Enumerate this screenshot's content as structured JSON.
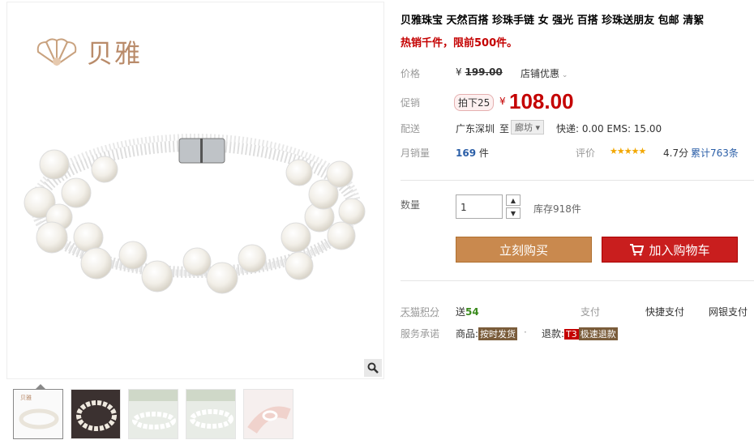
{
  "brand": {
    "logo_text": "贝雅"
  },
  "product": {
    "title": "贝雅珠宝 天然百搭 珍珠手链 女 强光 百搭 珍珠送朋友 包邮 清絮",
    "subtitle": "热销千件，限前500件。"
  },
  "price": {
    "label": "价格",
    "currency": "¥",
    "original": "199.00",
    "store_discount": "店铺优惠",
    "promo_label": "促销",
    "promo_chip": "拍下25",
    "promo_price": "108.00"
  },
  "shipping": {
    "label": "配送",
    "from": "广东深圳",
    "to_word": "至",
    "to_city": "廊坊",
    "fees": "快递: 0.00 EMS: 15.00"
  },
  "sales": {
    "label": "月销量",
    "count": "169",
    "unit": "件",
    "rating_label": "评价",
    "stars": "★★★★★",
    "rating": "4.7分",
    "reviews": "累计763条"
  },
  "quantity": {
    "label": "数量",
    "value": "1",
    "stock": "库存918件",
    "up": "▲",
    "down": "▼"
  },
  "actions": {
    "buy": "立刻购买",
    "cart": "加入购物车"
  },
  "points": {
    "label": "天猫积分",
    "value_prefix": "送",
    "value": "54",
    "pay_label": "支付",
    "pay1": "快捷支付",
    "pay2": "网银支付"
  },
  "service": {
    "label": "服务承诺",
    "goods": "商品:",
    "goods_tag": "按时发货",
    "dot": "·",
    "refund": "退款:",
    "t3": "T3",
    "refund_tag": "极速退款"
  },
  "colors": {
    "accent": "#c40000",
    "buy": "#c9894e",
    "cart": "#c91e1e"
  }
}
